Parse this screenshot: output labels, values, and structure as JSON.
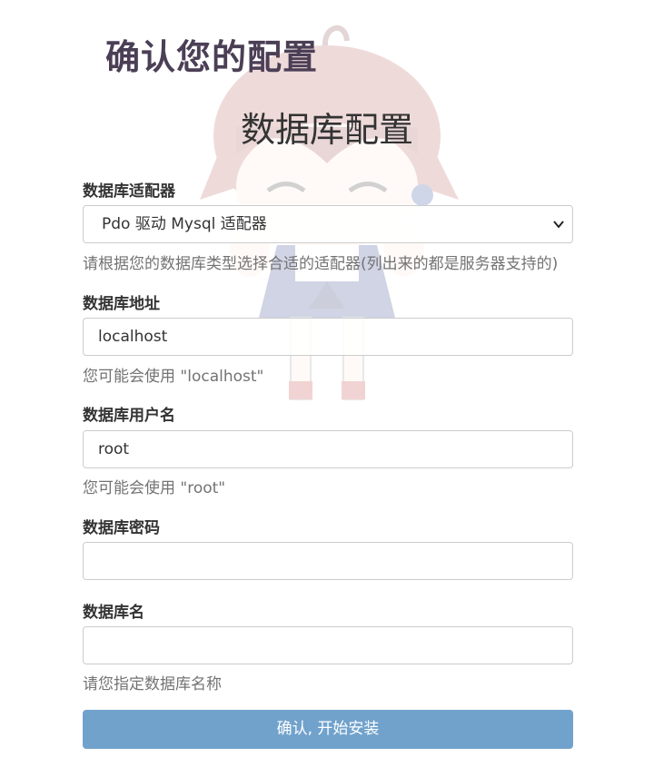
{
  "page": {
    "app_title": "确认您的配置",
    "section_title": "数据库配置"
  },
  "form": {
    "adapter": {
      "label": "数据库适配器",
      "value": "Pdo 驱动 Mysql 适配器",
      "help": "请根据您的数据库类型选择合适的适配器(列出来的都是服务器支持的)"
    },
    "host": {
      "label": "数据库地址",
      "value": "localhost",
      "help": "您可能会使用 \"localhost\""
    },
    "user": {
      "label": "数据库用户名",
      "value": "root",
      "help": "您可能会使用 \"root\""
    },
    "password": {
      "label": "数据库密码",
      "value": ""
    },
    "dbname": {
      "label": "数据库名",
      "value": "",
      "help": "请您指定数据库名称"
    },
    "submit_label": "确认, 开始安装"
  },
  "colors": {
    "title": "#4b3f56",
    "button": "#71a2cc",
    "help_text": "#737373",
    "border": "#cccccc"
  },
  "icons": {
    "select_chevron": "chevron-down-icon",
    "mascot": "mascot-illustration"
  }
}
